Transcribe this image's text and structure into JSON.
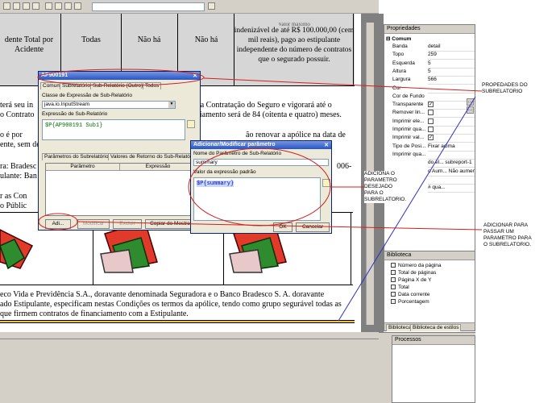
{
  "document": {
    "header_cells": [
      "dente Total por Acidente",
      "Todas",
      "Não há",
      "Não há",
      "indenizável de até R$ 100.000,00 (cem mil reais), pago ao estipulante independente do número de contratos que o segurado possuir."
    ],
    "header_top_cut": "Valor máximo",
    "lines": [
      "terá seu in",
      "o Contrato",
      "o é por",
      "ente, sem de",
      "ra: Bradesc",
      "ulante: Ban",
      "r as Con",
      "o Públic",
      "eco Vida e Previdência S.A., doravante denominada Seguradora e o Banco Bradesco S. A. doravante",
      "ado Estipulante, especificam nestas Condições os termos da apólice, tendo como grupo segurável todas as",
      "que firmem contratos de financiamento com a Estipulante."
    ],
    "right_lines": [
      "ta da Contratação do Seguro e vigorará até o",
      "anciamento será de 84 (oitenta e quatro) meses.",
      "ão renovar a apólice na data de",
      "006-"
    ]
  },
  "subreport_dialog": {
    "title": "AP900191",
    "tabs": [
      "Comum",
      "Subrelatório",
      "Sub-Relatório (Outro)",
      "Todos"
    ],
    "class_label": "Classe de Expressão de Sub-Relatório",
    "class_value": "java.io.InputStream",
    "expr_label": "Expressão de Sub-Relatório",
    "expr_value": "$P{AP900191 Sub1}",
    "inner_tabs": [
      "Parâmetros do Subrelatório",
      "Valores de Retorno do Sub-Relatório"
    ],
    "col_headers": [
      "Parâmetro",
      "Expressão"
    ],
    "buttons": [
      "Adi...",
      "Modificar",
      "Excluir",
      "Copiar do Mestre"
    ]
  },
  "param_dialog": {
    "title": "Adicionar/Modificar parâmetro",
    "name_label": "Nome do Parâmetro de Sub-Relatório",
    "name_value": "summary",
    "value_label": "Valor da expressão padrão",
    "value_value": "$P{summary}",
    "ok": "OK",
    "cancel": "Cancelar"
  },
  "properties": {
    "title": "Propriedades",
    "section": "Comum",
    "rows": [
      {
        "k": "Banda",
        "v": "detail"
      },
      {
        "k": "Topo",
        "v": "259"
      },
      {
        "k": "Esquerda",
        "v": "5"
      },
      {
        "k": "Altura",
        "v": "5"
      },
      {
        "k": "Largura",
        "v": "566"
      },
      {
        "k": "Cor",
        "v": ""
      },
      {
        "k": "Cor de Fundo",
        "v": ""
      },
      {
        "k": "Transparente",
        "v": "check"
      },
      {
        "k": "Remover lin...",
        "v": "box"
      },
      {
        "k": "Imprimir ele...",
        "v": "box"
      },
      {
        "k": "Imprimir qua...",
        "v": "box"
      },
      {
        "k": "Imprimir val...",
        "v": "check"
      },
      {
        "k": "Tipo de Posi...",
        "v": "Fixar acima"
      },
      {
        "k": "Imprimir qua...",
        "v": ""
      },
      {
        "k": "",
        "v": "do el...  subreport-1"
      },
      {
        "k": "",
        "v": "o Aum...  Não aumentar"
      },
      {
        "k": "",
        "v": ""
      },
      {
        "k": "",
        "v": "# qua..."
      }
    ]
  },
  "biblioteca": {
    "title": "Biblioteca",
    "items": [
      "Número da página",
      "Total de páginas",
      "Página X de Y",
      "Total",
      "Data corrente",
      "Porcentagem"
    ],
    "tabs": [
      "Biblioteca",
      "Biblioteca de estilos"
    ]
  },
  "processos": {
    "title": "Processos"
  },
  "annotations": {
    "propriedades": "PROPEDADES DO SUBRELATORIO",
    "parametro": "ADICIONA O PARAMETRO DESEJADO PARA O SUBRELATORIO.",
    "adicionar": "ADICIONAR PARA PASSAR UM PARAMETRO PARA O SUBRELATORIO."
  }
}
